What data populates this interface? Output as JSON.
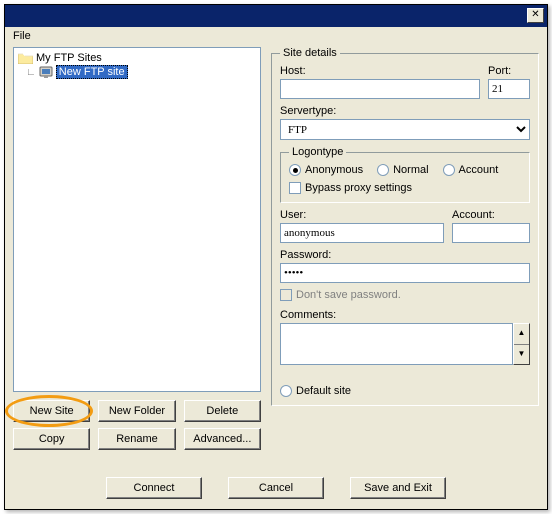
{
  "titlebar": {
    "close": "✕"
  },
  "menu": {
    "file": "File"
  },
  "tree": {
    "root": "My FTP Sites",
    "child": "New FTP site"
  },
  "buttons": {
    "new_site": "New Site",
    "new_folder": "New Folder",
    "delete": "Delete",
    "copy": "Copy",
    "rename": "Rename",
    "advanced": "Advanced..."
  },
  "details": {
    "legend": "Site details",
    "host_label": "Host:",
    "host_value": "",
    "port_label": "Port:",
    "port_value": "21",
    "servertype_label": "Servertype:",
    "servertype_value": "FTP",
    "logon": {
      "legend": "Logontype",
      "anonymous": "Anonymous",
      "normal": "Normal",
      "account": "Account",
      "bypass": "Bypass proxy settings"
    },
    "user_label": "User:",
    "user_value": "anonymous",
    "account_label": "Account:",
    "account_value": "",
    "password_label": "Password:",
    "password_value": "•••••",
    "dont_save": "Don't save password.",
    "comments_label": "Comments:",
    "comments_value": "",
    "default_site": "Default site"
  },
  "footer": {
    "connect": "Connect",
    "cancel": "Cancel",
    "save_exit": "Save and Exit"
  }
}
